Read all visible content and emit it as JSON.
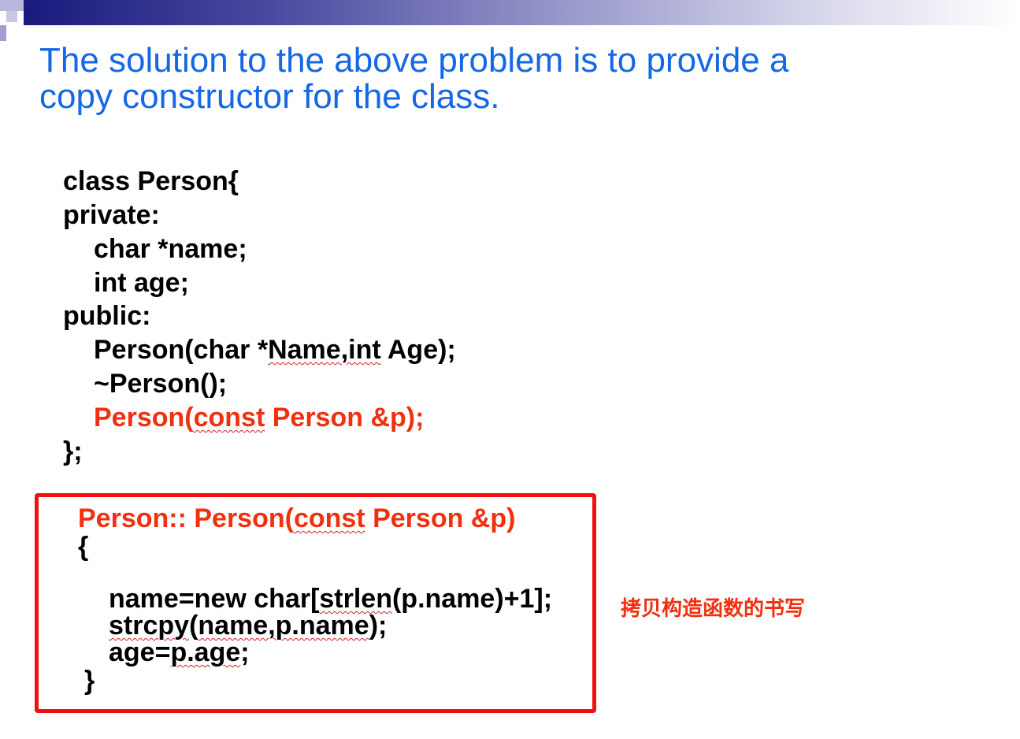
{
  "slide": {
    "title_line1": "The solution to the above problem is to provide a",
    "title_line2": "copy constructor for the class.",
    "colors": {
      "title": "#1467e6",
      "highlight": "#f0300e",
      "box_border": "#f01010",
      "text": "#000000"
    }
  },
  "class_code": {
    "l1": "class Person{",
    "l2": "private:",
    "l3": "char *name;",
    "l4": "int age;",
    "l5": "public:",
    "l6_a": "Person(char *",
    "l6_b": "Name,int",
    "l6_c": " Age);",
    "l7": "~Person();",
    "l8_a": "Person(",
    "l8_b": "const",
    "l8_c": " Person &p);",
    "l9": "};"
  },
  "copy_ctor": {
    "l1_a": "Person:: Person(",
    "l1_b": "const",
    "l1_c": " Person &p)",
    "l2": "{",
    "l3_a": "name=new char[",
    "l3_b": "strlen",
    "l3_c": "(p.name)+1];",
    "l4_a": "strcpy",
    "l4_b": "(",
    "l4_c": "name,p.name",
    "l4_d": ");",
    "l5_a": "age=",
    "l5_b": "p.age",
    "l5_c": ";",
    "l6": "}"
  },
  "annotation": {
    "text": "拷贝构造函数的书写"
  }
}
